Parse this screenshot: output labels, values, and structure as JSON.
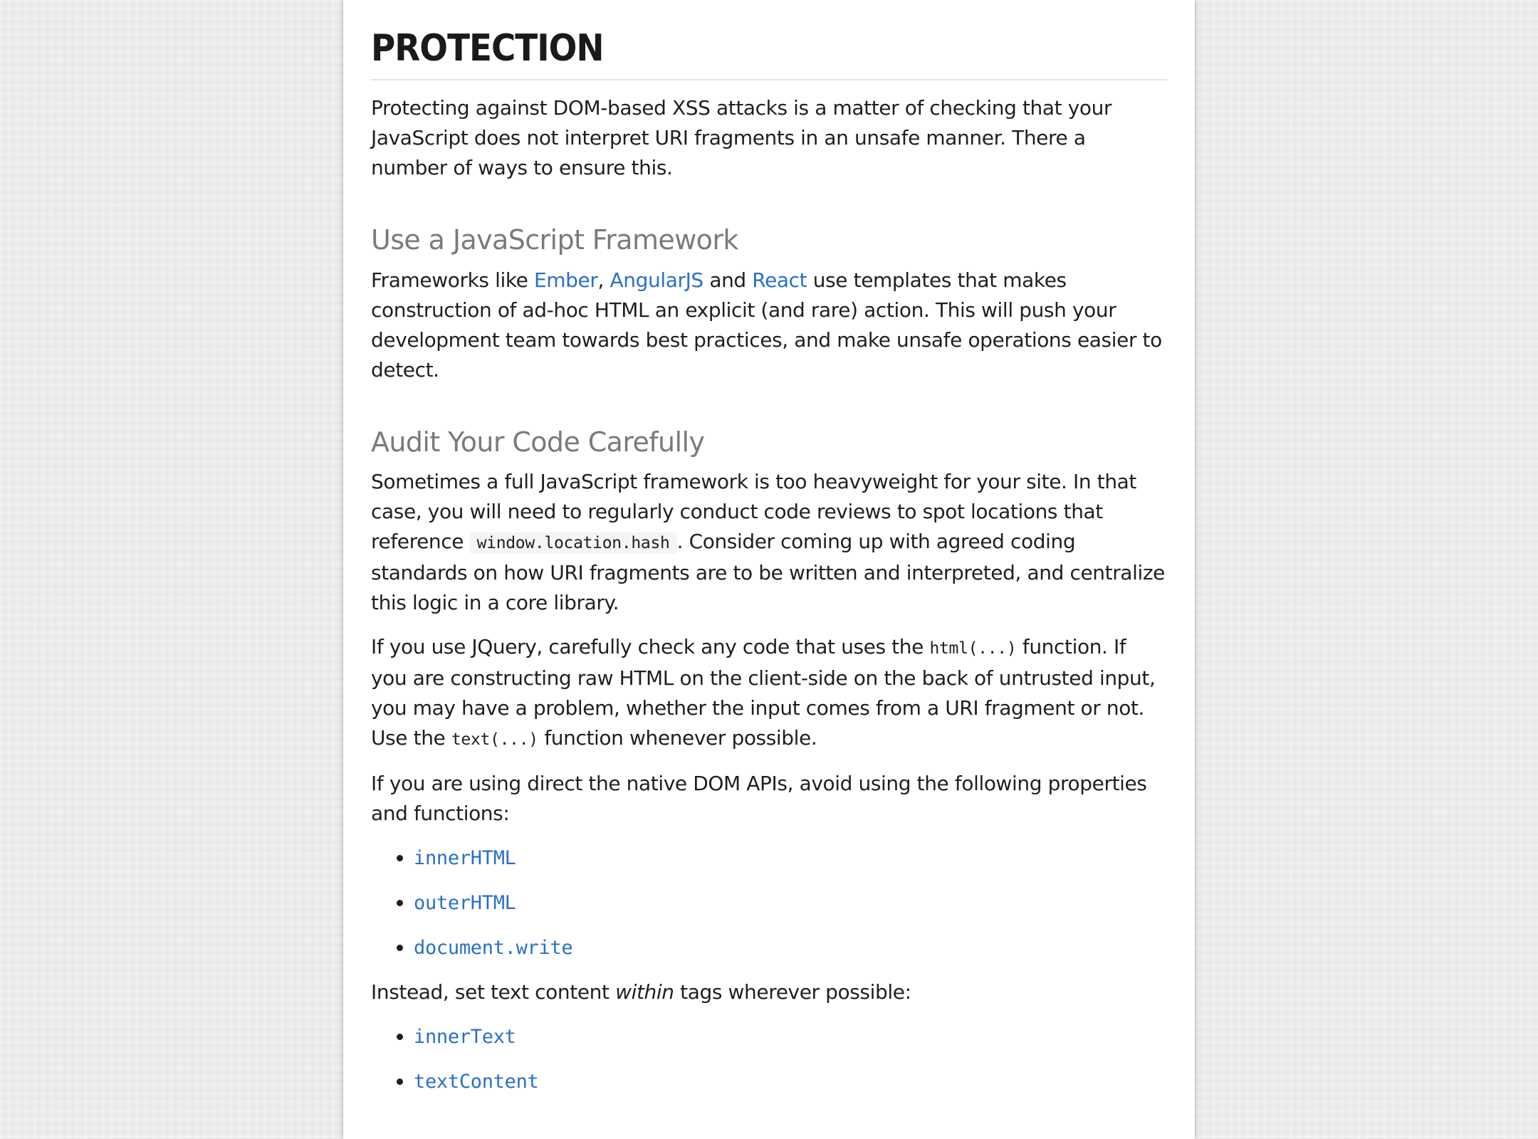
{
  "page": {
    "title": "PROTECTION",
    "intro": "Protecting against DOM-based XSS attacks is a matter of checking that your JavaScript does not interpret URI fragments in an unsafe manner. There a number of ways to ensure this."
  },
  "section_framework": {
    "heading": "Use a JavaScript Framework",
    "text_before": "Frameworks like ",
    "link_ember": "Ember",
    "sep1": ", ",
    "link_angular": "AngularJS",
    "sep2": " and ",
    "link_react": "React",
    "text_after": " use templates that makes construction of ad-hoc HTML an explicit (and rare) action. This will push your development team towards best practices, and make unsafe operations easier to detect."
  },
  "section_audit": {
    "heading": "Audit Your Code Carefully",
    "p1_before": "Sometimes a full JavaScript framework is too heavyweight for your site. In that case, you will need to regularly conduct code reviews to spot locations that reference ",
    "p1_code": "window.location.hash",
    "p1_after": ". Consider coming up with agreed coding standards on how URI fragments are to be written and interpreted, and centralize this logic in a core library.",
    "p2_before": "If you use JQuery, carefully check any code that uses the ",
    "p2_code1": "html(...)",
    "p2_mid": " function. If you are constructing raw HTML on the client-side on the back of untrusted input, you may have a problem, whether the input comes from a URI fragment or not. Use the ",
    "p2_code2": "text(...)",
    "p2_after": " function whenever possible.",
    "p3": "If you are using direct the native DOM APIs, avoid using the following properties and functions:",
    "avoid_list": [
      "innerHTML",
      "outerHTML",
      "document.write"
    ],
    "p4_before": "Instead, set text content ",
    "p4_em": "within",
    "p4_after": " tags wherever possible:",
    "use_list": [
      "innerText",
      "textContent"
    ]
  },
  "colors": {
    "link": "#2a6fc7",
    "heading_secondary": "#7a7a7a",
    "text": "#1f1f1f"
  }
}
